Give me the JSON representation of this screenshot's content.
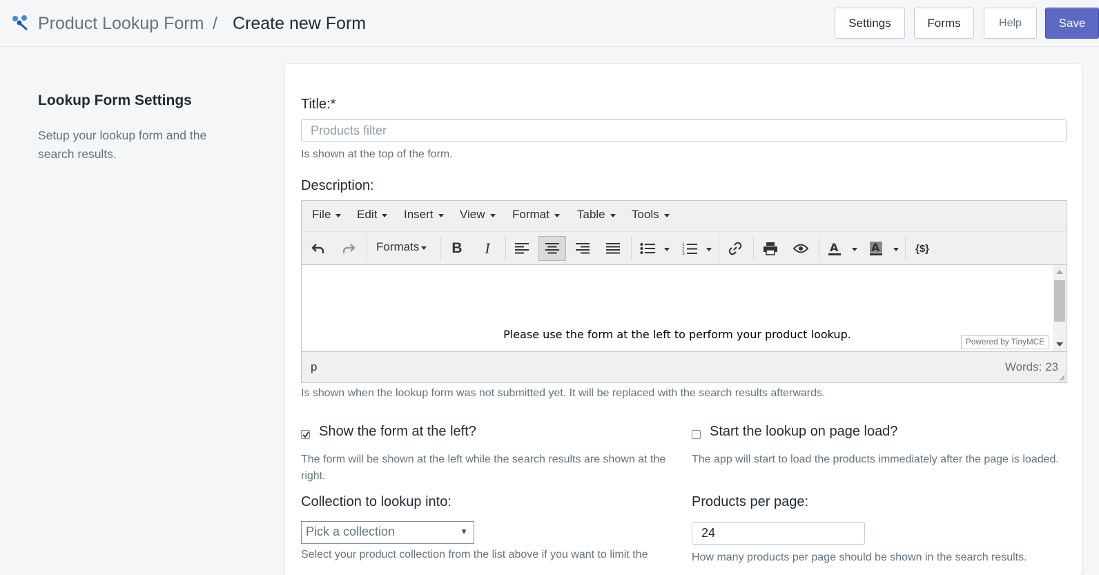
{
  "header": {
    "app_name": "Product Lookup Form",
    "separator": "/",
    "page_title": "Create new Form",
    "buttons": {
      "settings": "Settings",
      "forms": "Forms",
      "help": "Help",
      "save": "Save"
    },
    "accent_color": "#5c6ac4"
  },
  "sidebar": {
    "title": "Lookup Form Settings",
    "description": "Setup your lookup form and the search results."
  },
  "form": {
    "title": {
      "label": "Title:*",
      "placeholder": "Products filter",
      "help": "Is shown at the top of the form."
    },
    "description": {
      "label": "Description:",
      "menu": [
        "File",
        "Edit",
        "Insert",
        "View",
        "Format",
        "Table",
        "Tools"
      ],
      "formats_label": "Formats",
      "content": "Please use the form at the left to perform your product lookup.",
      "powered_by": "Powered by TinyMCE",
      "path": "p",
      "word_count": "Words: 23",
      "help": "Is shown when the lookup form was not submitted yet. It will be replaced with the search results afterwards."
    },
    "show_left": {
      "label": "Show the form at the left?",
      "checked": true,
      "help": "The form will be shown at the left while the search results are shown at the right."
    },
    "start_on_load": {
      "label": "Start the lookup on page load?",
      "checked": false,
      "help": "The app will start to load the products immediately after the page is loaded."
    },
    "collection": {
      "label": "Collection to lookup into:",
      "selected": "Pick a collection",
      "help": "Select your product collection from the list above if you want to limit the"
    },
    "per_page": {
      "label": "Products per page:",
      "value": "24",
      "help": "How many products per page should be shown in the search results."
    }
  }
}
